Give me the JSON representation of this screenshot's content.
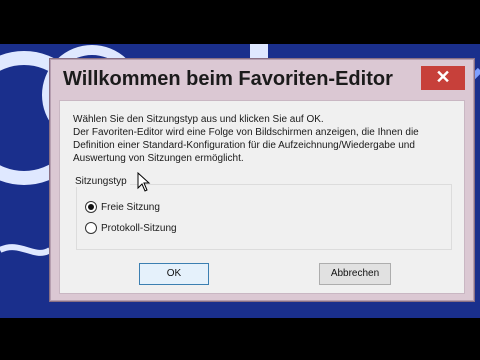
{
  "dialog": {
    "title": "Willkommen beim Favoriten-Editor",
    "close_glyph": "✕",
    "description": "Wählen Sie den Sitzungstyp aus und klicken Sie auf OK.\nDer Favoriten-Editor wird eine Folge von Bildschirmen anzeigen, die Ihnen die Definition einer Standard-Konfiguration für die Aufzeichnung/Wiedergabe und Auswertung von Sitzungen ermöglicht.",
    "group_label": "Sitzungstyp",
    "options": [
      {
        "label": "Freie Sitzung",
        "checked": true
      },
      {
        "label": "Protokoll-Sitzung",
        "checked": false
      }
    ],
    "ok_label": "OK",
    "cancel_label": "Abbrechen"
  },
  "colors": {
    "desktop_bg": "#1a2f8c",
    "dialog_frame": "#dbc8d3",
    "close_button": "#c7403a",
    "dialog_client": "#f0f0f0"
  },
  "icons": {
    "close": "close-icon",
    "cursor": "mouse-pointer-icon"
  }
}
